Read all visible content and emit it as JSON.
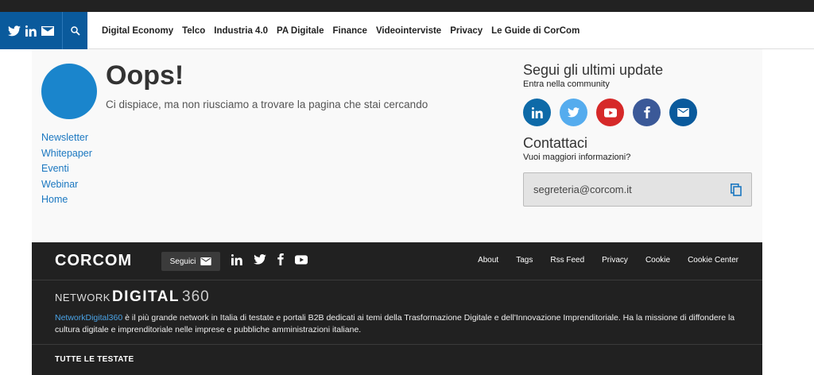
{
  "nav": {
    "items": [
      "Digital Economy",
      "Telco",
      "Industria 4.0",
      "PA Digitale",
      "Finance",
      "Videointerviste",
      "Privacy",
      "Le Guide di CorCom"
    ]
  },
  "main": {
    "title": "Oops!",
    "subtitle": "Ci dispiace, ma non riusciamo a trovare la pagina che stai cercando",
    "links": [
      "Newsletter",
      "Whitepaper",
      "Eventi",
      "Webinar",
      "Home"
    ]
  },
  "follow": {
    "title": "Segui gli ultimi update",
    "subtitle": "Entra nella community",
    "colors": {
      "linkedin": "#0e6aa8",
      "twitter": "#55acee",
      "youtube": "#d62929",
      "facebook": "#3b5998",
      "email": "#0a5a9c"
    }
  },
  "contact": {
    "title": "Contattaci",
    "subtitle": "Vuoi maggiori informazioni?",
    "email": "segreteria@corcom.it"
  },
  "footer": {
    "logo": "CORCOM",
    "seguici_label": "Seguici",
    "links": [
      "About",
      "Tags",
      "Rss Feed",
      "Privacy",
      "Cookie",
      "Cookie Center"
    ],
    "network_small": "NETWORK",
    "network_big": "DIGITAL",
    "network_num": "360",
    "network_name": "NetworkDigital360",
    "network_desc": " è il più grande network in Italia di testate e portali B2B dedicati ai temi della Trasformazione Digitale e dell'Innovazione Imprenditoriale. Ha la missione di diffondere la cultura digitale e imprenditoriale nelle imprese e pubbliche amministrazioni italiane.",
    "tutte_label": "TUTTE LE TESTATE"
  }
}
